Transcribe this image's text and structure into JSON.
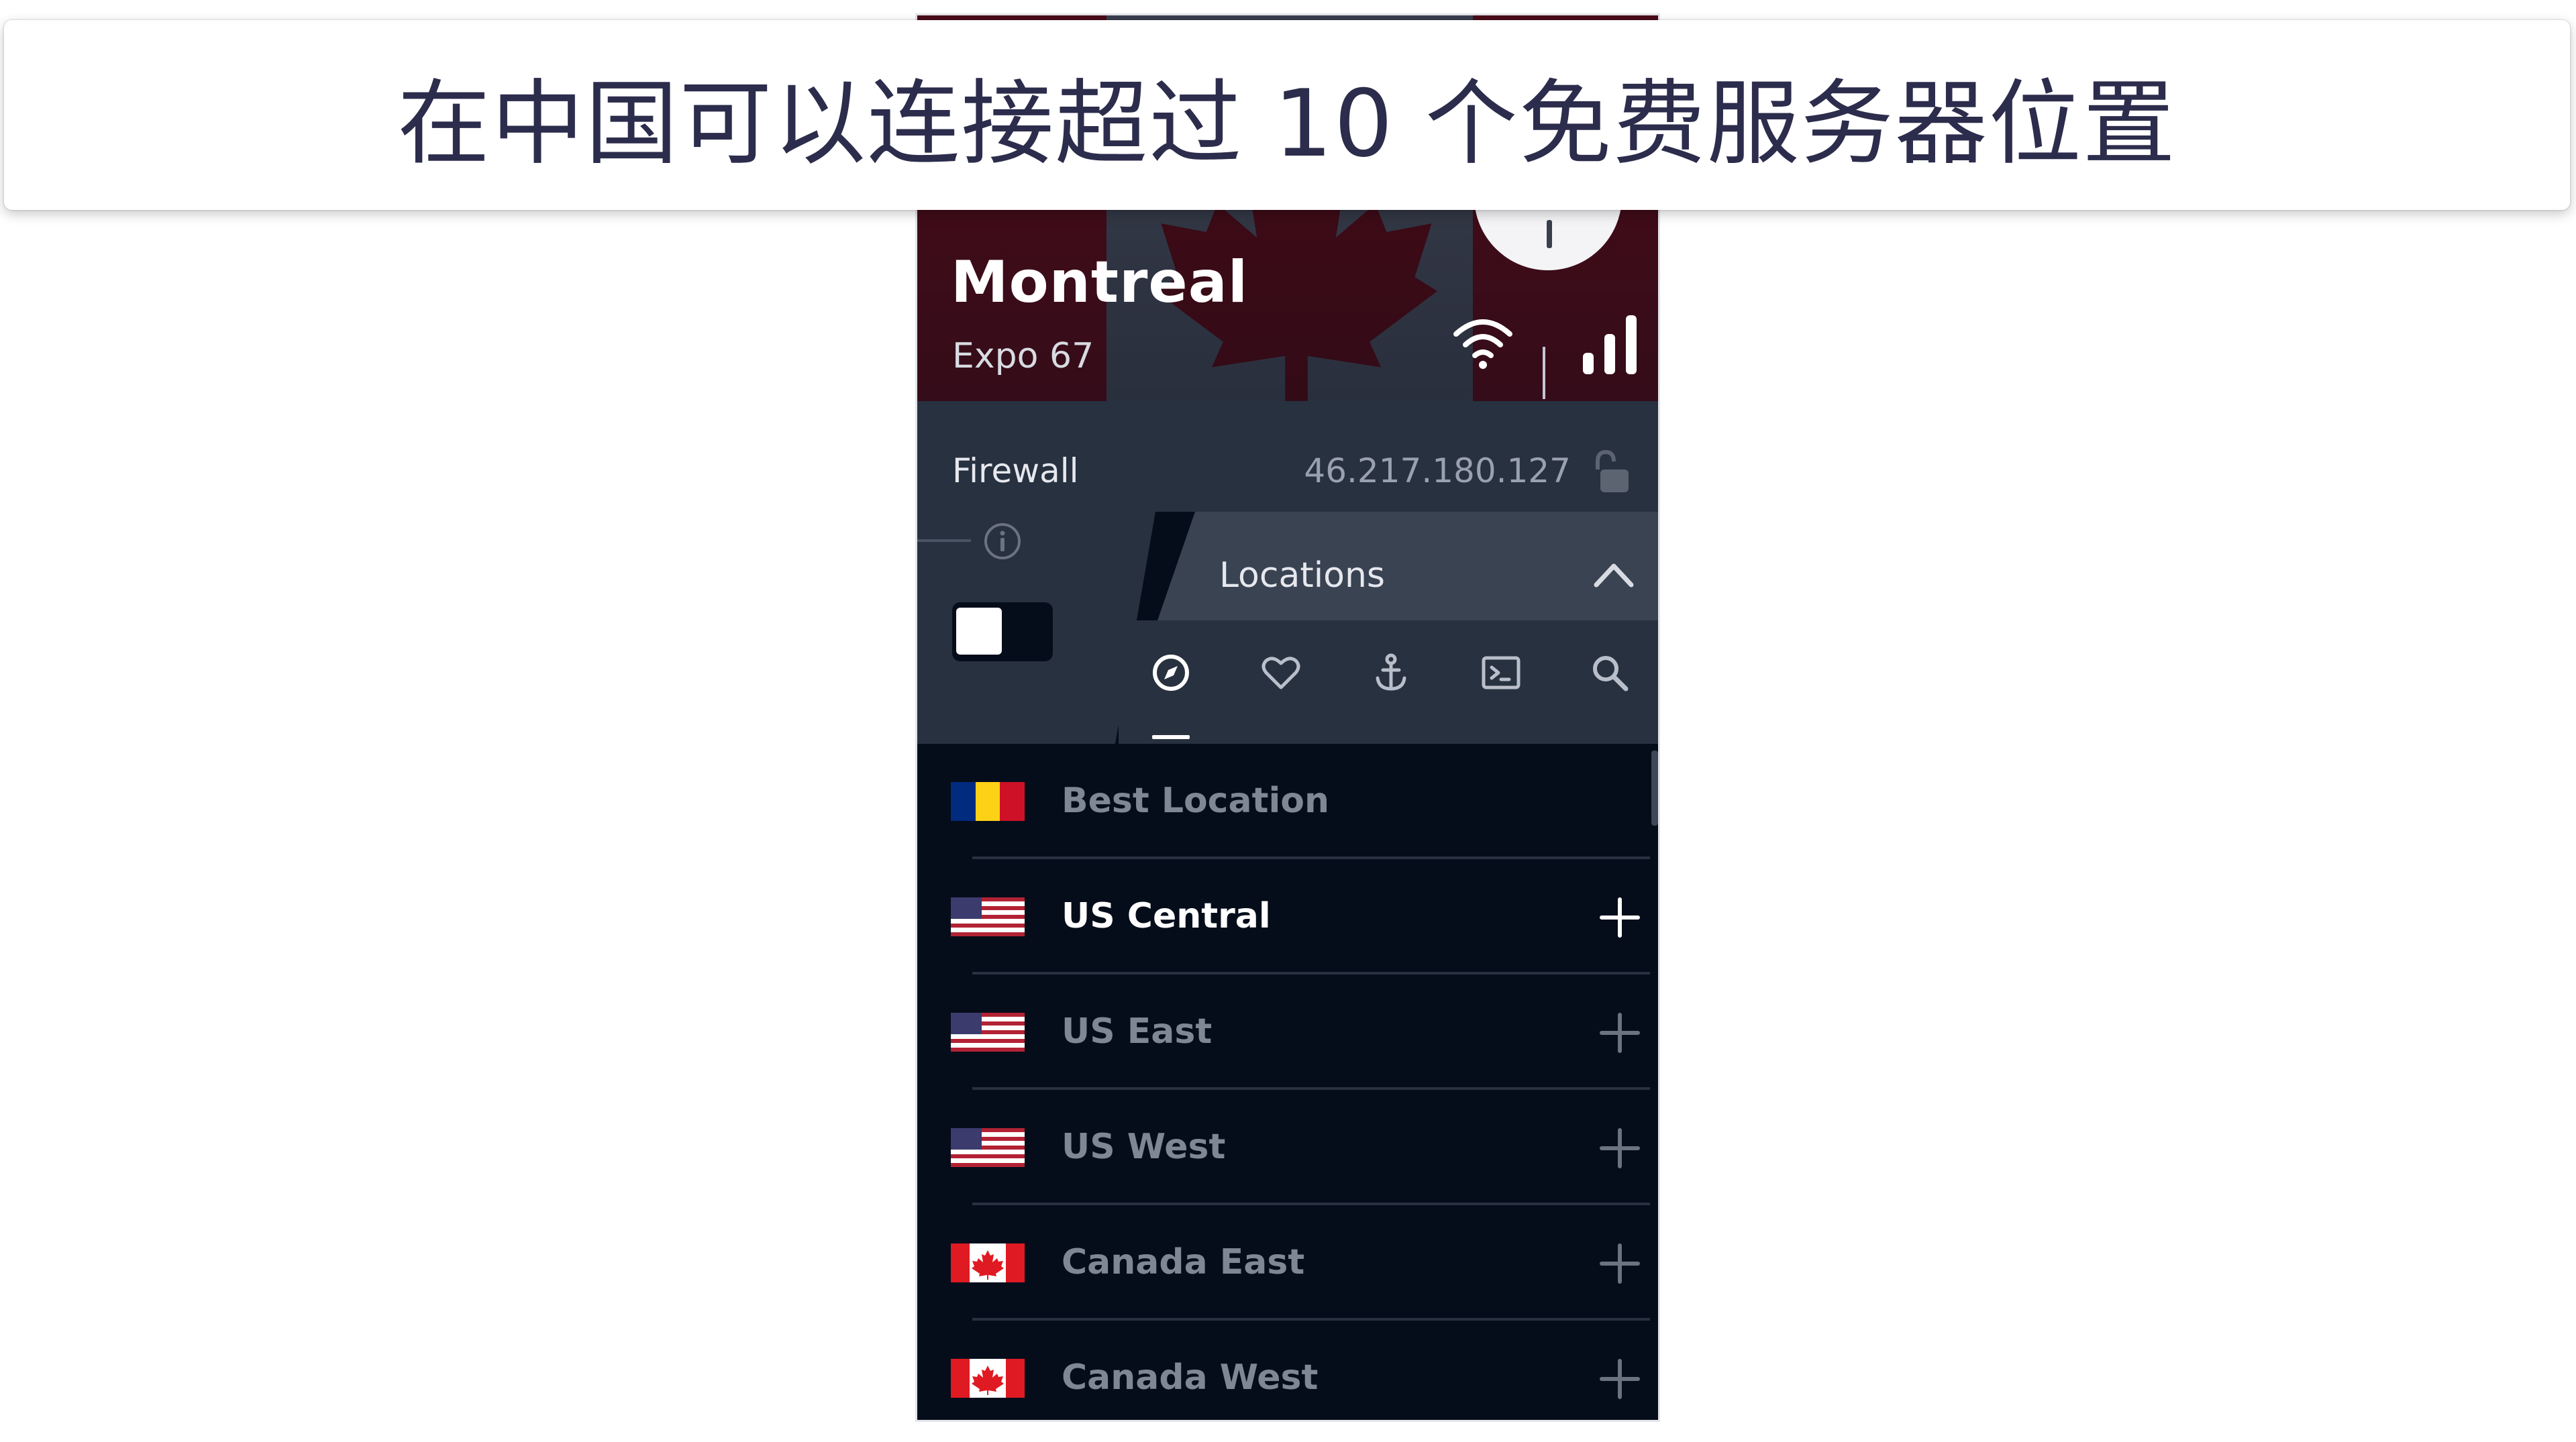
{
  "caption": "在中国可以连接超过 10 个免费服务器位置",
  "header": {
    "city": "Montreal",
    "server": "Expo 67",
    "flag": "canada",
    "icons": [
      "wifi-icon",
      "signal-bars-icon"
    ]
  },
  "firewall": {
    "label": "Firewall",
    "ip": "46.217.180.127",
    "toggle_on": false
  },
  "locations_panel": {
    "title": "Locations",
    "tabs": [
      {
        "icon": "compass-icon",
        "active": true
      },
      {
        "icon": "heart-icon",
        "active": false
      },
      {
        "icon": "anchor-icon",
        "active": false
      },
      {
        "icon": "terminal-icon",
        "active": false
      },
      {
        "icon": "search-icon",
        "active": false
      }
    ]
  },
  "locations": [
    {
      "label": "Best Location",
      "flag": "romania",
      "active": false,
      "expandable": false
    },
    {
      "label": "US Central",
      "flag": "usa",
      "active": true,
      "expandable": true
    },
    {
      "label": "US East",
      "flag": "usa",
      "active": false,
      "expandable": true
    },
    {
      "label": "US West",
      "flag": "usa",
      "active": false,
      "expandable": true
    },
    {
      "label": "Canada East",
      "flag": "canada",
      "active": false,
      "expandable": true
    },
    {
      "label": "Canada West",
      "flag": "canada",
      "active": false,
      "expandable": true
    }
  ],
  "colors": {
    "background": "#050d1b",
    "panel": "#27313f",
    "flag_red": "#e01a22",
    "text_muted": "#7f8694",
    "text_active": "#ffffff"
  }
}
